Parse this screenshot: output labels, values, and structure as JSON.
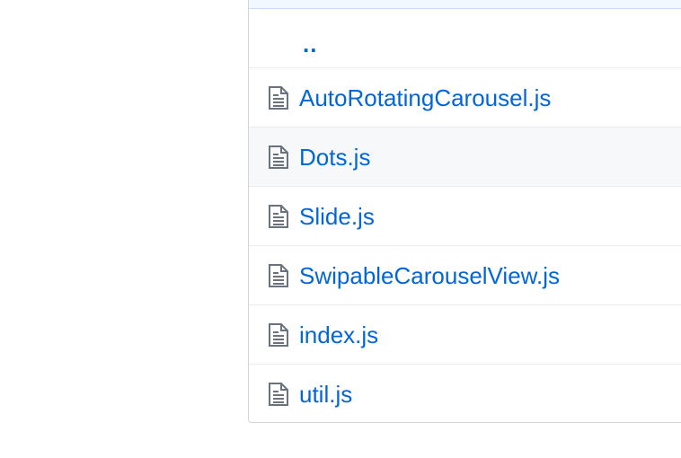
{
  "file_browser": {
    "parent_dir_label": "..",
    "files": [
      {
        "name": "AutoRotatingCarousel.js",
        "icon": "file-text-icon"
      },
      {
        "name": "Dots.js",
        "icon": "file-text-icon"
      },
      {
        "name": "Slide.js",
        "icon": "file-text-icon"
      },
      {
        "name": "SwipableCarouselView.js",
        "icon": "file-text-icon"
      },
      {
        "name": "index.js",
        "icon": "file-text-icon"
      },
      {
        "name": "util.js",
        "icon": "file-text-icon"
      }
    ]
  },
  "colors": {
    "link": "#0366d6",
    "icon": "#6a737d",
    "border": "#d1d5da",
    "row_divider": "#eaecef",
    "hover_row": "#f6f8fa",
    "header_strip": "#f1f8ff"
  }
}
